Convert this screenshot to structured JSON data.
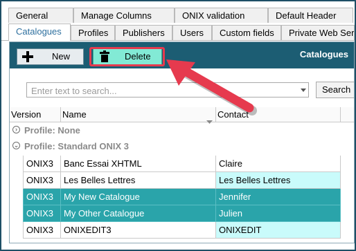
{
  "tabs_row1": [
    {
      "label": "General"
    },
    {
      "label": "Manage Columns"
    },
    {
      "label": "ONIX validation"
    },
    {
      "label": "Default Header"
    }
  ],
  "tabs_row2": [
    {
      "label": "Catalogues",
      "active": true
    },
    {
      "label": "Profiles"
    },
    {
      "label": "Publishers"
    },
    {
      "label": "Users"
    },
    {
      "label": "Custom fields"
    },
    {
      "label": "Private Web Serv"
    }
  ],
  "toolbar": {
    "new_label": "New",
    "delete_label": "Delete",
    "title": "Catalogues"
  },
  "search": {
    "placeholder": "Enter text to search...",
    "button_label": "Search"
  },
  "grid": {
    "columns": [
      "Version",
      "Name",
      "Contact"
    ],
    "groups": [
      {
        "label": "Profile: None",
        "state": "collapsed"
      },
      {
        "label": "Profile: Standard ONIX 3",
        "state": "expanded"
      }
    ],
    "rows": [
      {
        "version": "ONIX3",
        "name": "Banc Essai XHTML",
        "contact": "Claire",
        "selected": false,
        "contact_highlight": false
      },
      {
        "version": "ONIX3",
        "name": "Les Belles Lettres",
        "contact": "Les Belles Lettres",
        "selected": false,
        "contact_highlight": true
      },
      {
        "version": "ONIX3",
        "name": "My New Catalogue",
        "contact": "Jennifer",
        "selected": true,
        "contact_highlight": false
      },
      {
        "version": "ONIX3",
        "name": "My Other Catalogue",
        "contact": "Julien",
        "selected": true,
        "contact_highlight": false
      },
      {
        "version": "ONIX3",
        "name": "ONIXEDIT3",
        "contact": "ONIXEDIT",
        "selected": false,
        "contact_highlight": true
      }
    ]
  },
  "colors": {
    "toolbar_bg": "#1c5d73",
    "selected_row": "#2aa4aa",
    "highlight_cell": "#c9fbfb",
    "delete_button": "#82ead5",
    "annotation_red": "#e63a4e"
  },
  "icons": {
    "new": "plus-icon",
    "delete": "trash-icon",
    "search_dropdown": "chevron-down-icon",
    "annotation": "arrow-icon"
  }
}
